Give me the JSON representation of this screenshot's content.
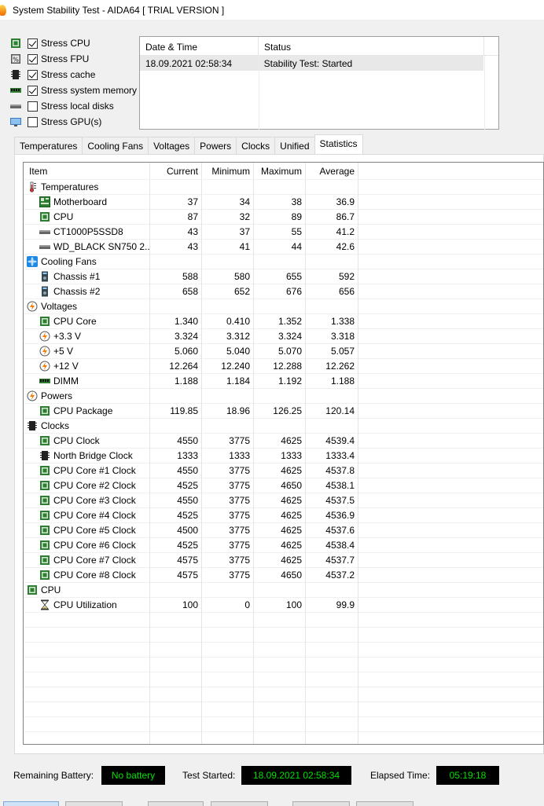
{
  "window": {
    "title": "System Stability Test - AIDA64  [ TRIAL VERSION ]"
  },
  "stress": [
    {
      "label": "Stress CPU",
      "checked": true,
      "icon": "cpu-icon"
    },
    {
      "label": "Stress FPU",
      "checked": true,
      "icon": "fpu-icon"
    },
    {
      "label": "Stress cache",
      "checked": true,
      "icon": "cache-icon"
    },
    {
      "label": "Stress system memory",
      "checked": true,
      "icon": "memory-icon"
    },
    {
      "label": "Stress local disks",
      "checked": false,
      "icon": "disk-icon"
    },
    {
      "label": "Stress GPU(s)",
      "checked": false,
      "icon": "gpu-icon"
    }
  ],
  "status_table": {
    "col_date": "Date & Time",
    "col_status": "Status",
    "rows": [
      {
        "date": "18.09.2021 02:58:34",
        "status": "Stability Test: Started"
      }
    ]
  },
  "tabs": [
    "Temperatures",
    "Cooling Fans",
    "Voltages",
    "Powers",
    "Clocks",
    "Unified",
    "Statistics"
  ],
  "active_tab": "Statistics",
  "stats": {
    "headers": {
      "item": "Item",
      "current": "Current",
      "minimum": "Minimum",
      "maximum": "Maximum",
      "average": "Average"
    },
    "rows": [
      {
        "type": "group",
        "label": "Temperatures",
        "icon": "thermometer-icon"
      },
      {
        "type": "item",
        "label": "Motherboard",
        "icon": "motherboard-icon",
        "cur": "37",
        "min": "34",
        "max": "38",
        "avg": "36.9"
      },
      {
        "type": "item",
        "label": "CPU",
        "icon": "cpu-icon",
        "cur": "87",
        "min": "32",
        "max": "89",
        "avg": "86.7"
      },
      {
        "type": "item",
        "label": "CT1000P5SSD8",
        "icon": "disk-icon",
        "cur": "43",
        "min": "37",
        "max": "55",
        "avg": "41.2"
      },
      {
        "type": "item",
        "label": "WD_BLACK  SN750 2...",
        "icon": "disk-icon",
        "cur": "43",
        "min": "41",
        "max": "44",
        "avg": "42.6"
      },
      {
        "type": "group",
        "label": "Cooling Fans",
        "icon": "fan-icon"
      },
      {
        "type": "item",
        "label": "Chassis #1",
        "icon": "chassis-icon",
        "cur": "588",
        "min": "580",
        "max": "655",
        "avg": "592"
      },
      {
        "type": "item",
        "label": "Chassis #2",
        "icon": "chassis-icon",
        "cur": "658",
        "min": "652",
        "max": "676",
        "avg": "656"
      },
      {
        "type": "group",
        "label": "Voltages",
        "icon": "bolt-icon"
      },
      {
        "type": "item",
        "label": "CPU Core",
        "icon": "cpu-icon",
        "cur": "1.340",
        "min": "0.410",
        "max": "1.352",
        "avg": "1.338"
      },
      {
        "type": "item",
        "label": "+3.3 V",
        "icon": "bolt-icon",
        "cur": "3.324",
        "min": "3.312",
        "max": "3.324",
        "avg": "3.318"
      },
      {
        "type": "item",
        "label": "+5 V",
        "icon": "bolt-icon",
        "cur": "5.060",
        "min": "5.040",
        "max": "5.070",
        "avg": "5.057"
      },
      {
        "type": "item",
        "label": "+12 V",
        "icon": "bolt-icon",
        "cur": "12.264",
        "min": "12.240",
        "max": "12.288",
        "avg": "12.262"
      },
      {
        "type": "item",
        "label": "DIMM",
        "icon": "memory-icon",
        "cur": "1.188",
        "min": "1.184",
        "max": "1.192",
        "avg": "1.188"
      },
      {
        "type": "group",
        "label": "Powers",
        "icon": "bolt-icon"
      },
      {
        "type": "item",
        "label": "CPU Package",
        "icon": "cpu-icon",
        "cur": "119.85",
        "min": "18.96",
        "max": "126.25",
        "avg": "120.14"
      },
      {
        "type": "group",
        "label": "Clocks",
        "icon": "chip-icon"
      },
      {
        "type": "item",
        "label": "CPU Clock",
        "icon": "cpu-icon",
        "cur": "4550",
        "min": "3775",
        "max": "4625",
        "avg": "4539.4"
      },
      {
        "type": "item",
        "label": "North Bridge Clock",
        "icon": "chip-icon",
        "cur": "1333",
        "min": "1333",
        "max": "1333",
        "avg": "1333.4"
      },
      {
        "type": "item",
        "label": "CPU Core #1 Clock",
        "icon": "cpu-icon",
        "cur": "4550",
        "min": "3775",
        "max": "4625",
        "avg": "4537.8"
      },
      {
        "type": "item",
        "label": "CPU Core #2 Clock",
        "icon": "cpu-icon",
        "cur": "4525",
        "min": "3775",
        "max": "4650",
        "avg": "4538.1"
      },
      {
        "type": "item",
        "label": "CPU Core #3 Clock",
        "icon": "cpu-icon",
        "cur": "4550",
        "min": "3775",
        "max": "4625",
        "avg": "4537.5"
      },
      {
        "type": "item",
        "label": "CPU Core #4 Clock",
        "icon": "cpu-icon",
        "cur": "4525",
        "min": "3775",
        "max": "4625",
        "avg": "4536.9"
      },
      {
        "type": "item",
        "label": "CPU Core #5 Clock",
        "icon": "cpu-icon",
        "cur": "4500",
        "min": "3775",
        "max": "4625",
        "avg": "4537.6"
      },
      {
        "type": "item",
        "label": "CPU Core #6 Clock",
        "icon": "cpu-icon",
        "cur": "4525",
        "min": "3775",
        "max": "4625",
        "avg": "4538.4"
      },
      {
        "type": "item",
        "label": "CPU Core #7 Clock",
        "icon": "cpu-icon",
        "cur": "4575",
        "min": "3775",
        "max": "4625",
        "avg": "4537.7"
      },
      {
        "type": "item",
        "label": "CPU Core #8 Clock",
        "icon": "cpu-icon",
        "cur": "4575",
        "min": "3775",
        "max": "4650",
        "avg": "4537.2"
      },
      {
        "type": "group",
        "label": "CPU",
        "icon": "cpu-icon"
      },
      {
        "type": "item",
        "label": "CPU Utilization",
        "icon": "hourglass-icon",
        "cur": "100",
        "min": "0",
        "max": "100",
        "avg": "99.9"
      }
    ]
  },
  "bottom": {
    "battery_label": "Remaining Battery:",
    "battery_value": "No battery",
    "started_label": "Test Started:",
    "started_value": "18.09.2021 02:58:34",
    "elapsed_label": "Elapsed Time:",
    "elapsed_value": "05:19:18"
  },
  "colors": {
    "readout_bg": "#000000",
    "readout_text": "#00e000",
    "tab_active": "#ffffff"
  }
}
